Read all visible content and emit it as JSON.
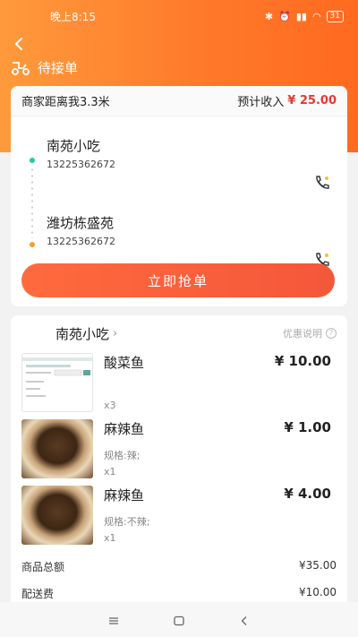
{
  "status_bar": {
    "time": "晚上8:15",
    "battery": "31"
  },
  "header": {
    "title": "待接单"
  },
  "order": {
    "distance_label": "商家距离我3.3米",
    "income_label": "预计收入",
    "income_amount": "¥ 25.00",
    "pickup": {
      "name": "南苑小吃",
      "phone": "13225362672"
    },
    "dropoff": {
      "name": "潍坊栋盛苑",
      "phone": "13225362672"
    },
    "grab_label": "立即抢单"
  },
  "detail": {
    "shop_name": "南苑小吃",
    "discount_label": "优惠说明",
    "items": [
      {
        "name": "酸菜鱼",
        "price": "¥ 10.00",
        "spec": "",
        "qty": "x3"
      },
      {
        "name": "麻辣鱼",
        "price": "¥ 1.00",
        "spec": "规格:辣;",
        "qty": "x1"
      },
      {
        "name": "麻辣鱼",
        "price": "¥ 4.00",
        "spec": "规格:不辣;",
        "qty": "x1"
      }
    ],
    "subtotal_label": "商品总额",
    "subtotal_value": "¥35.00",
    "delivery_label": "配送费",
    "delivery_value": "¥10.00"
  },
  "colors": {
    "accent": "#ff7a2b",
    "price_red": "#e53935",
    "grab_button": "#f4573a"
  }
}
